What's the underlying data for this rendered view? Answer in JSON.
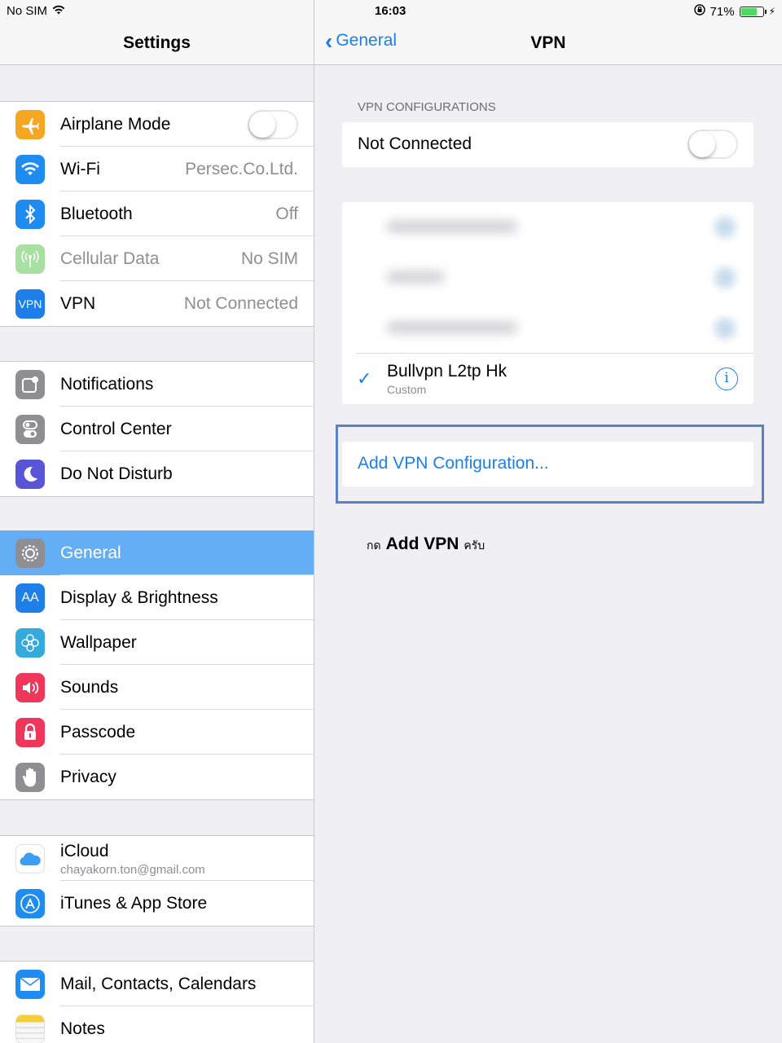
{
  "status_bar": {
    "carrier": "No SIM",
    "time": "16:03",
    "battery": "71%"
  },
  "left": {
    "title": "Settings",
    "groups": [
      [
        {
          "label": "Airplane Mode",
          "value": "",
          "icon": "airplane-icon",
          "color": "#f5a623"
        },
        {
          "label": "Wi-Fi",
          "value": "Persec.Co.Ltd.",
          "icon": "wifi-icon",
          "color": "#1e8cf0"
        },
        {
          "label": "Bluetooth",
          "value": "Off",
          "icon": "bluetooth-icon",
          "color": "#1e8cf0"
        },
        {
          "label": "Cellular Data",
          "value": "No SIM",
          "icon": "antenna-icon",
          "color": "#a8e0a2"
        },
        {
          "label": "VPN",
          "value": "Not Connected",
          "icon": "vpn-icon",
          "color": "#1e7fe8",
          "icon_text": "VPN"
        }
      ],
      [
        {
          "label": "Notifications",
          "icon": "notifications-icon",
          "color": "#8e8e93"
        },
        {
          "label": "Control Center",
          "icon": "control-center-icon",
          "color": "#8e8e93"
        },
        {
          "label": "Do Not Disturb",
          "icon": "moon-icon",
          "color": "#5856d6"
        }
      ],
      [
        {
          "label": "General",
          "icon": "gear-icon",
          "color": "#8e8e93"
        },
        {
          "label": "Display & Brightness",
          "icon": "display-icon",
          "color": "#1e7fe8",
          "icon_text": "AA"
        },
        {
          "label": "Wallpaper",
          "icon": "wallpaper-icon",
          "color": "#35aadc"
        },
        {
          "label": "Sounds",
          "icon": "speaker-icon",
          "color": "#f0365a"
        },
        {
          "label": "Passcode",
          "icon": "lock-icon",
          "color": "#f0365a"
        },
        {
          "label": "Privacy",
          "icon": "hand-icon",
          "color": "#8e8e93"
        }
      ],
      [
        {
          "label": "iCloud",
          "sublabel": "chayakorn.ton@gmail.com",
          "icon": "cloud-icon",
          "color": "#ffffff"
        },
        {
          "label": "iTunes & App Store",
          "icon": "app-store-icon",
          "color": "#1e8cf0"
        }
      ],
      [
        {
          "label": "Mail, Contacts, Calendars",
          "icon": "mail-icon",
          "color": "#1e8cf0"
        },
        {
          "label": "Notes",
          "icon": "notes-icon",
          "color": "#f7f7f7"
        }
      ]
    ]
  },
  "right": {
    "back_label": "General",
    "title": "VPN",
    "section_header": "VPN CONFIGURATIONS",
    "status_label": "Not Connected",
    "selected_config": {
      "name": "Bullvpn L2tp Hk",
      "type": "Custom"
    },
    "add_label": "Add VPN Configuration...",
    "instruction": {
      "prefix": "กด",
      "bold": "Add VPN",
      "suffix": "ครับ"
    }
  },
  "accent_color": "#1e7fe8",
  "selected_row_color": "#64aef5"
}
